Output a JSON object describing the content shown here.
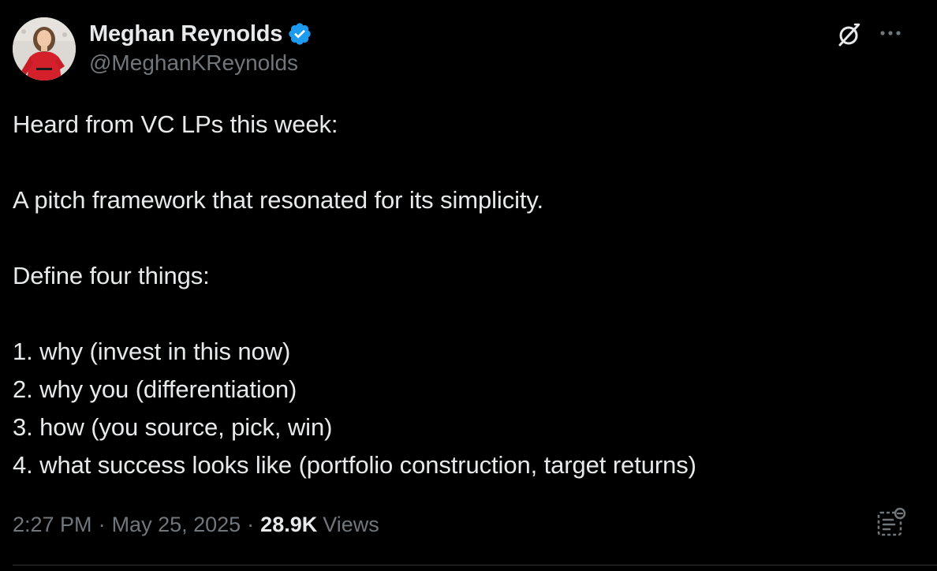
{
  "author": {
    "name": "Meghan Reynolds",
    "handle": "@MeghanKReynolds",
    "verified": true,
    "verified_color": "#1d9bf0",
    "avatar_icon": "profile-photo"
  },
  "header_actions": {
    "grok_icon": "grok-icon",
    "more_icon": "more-icon"
  },
  "tweet": {
    "lines": [
      "Heard from VC LPs this week:",
      "",
      "A pitch framework that resonated for its simplicity.",
      "",
      "Define four things:",
      "",
      "1. why (invest in this now)",
      "2. why you (differentiation)",
      "3. how (you source, pick, win)",
      "4. what success looks like (portfolio construction, target returns)"
    ]
  },
  "meta": {
    "time": "2:27 PM",
    "separator": "·",
    "date": "May 25, 2025",
    "views_count": "28.9K",
    "views_label": "Views",
    "analytics_icon": "analytics-icon"
  },
  "colors": {
    "background": "#000000",
    "text": "#e7e9ea",
    "secondary_text": "#71767b",
    "divider": "#2f3336"
  }
}
